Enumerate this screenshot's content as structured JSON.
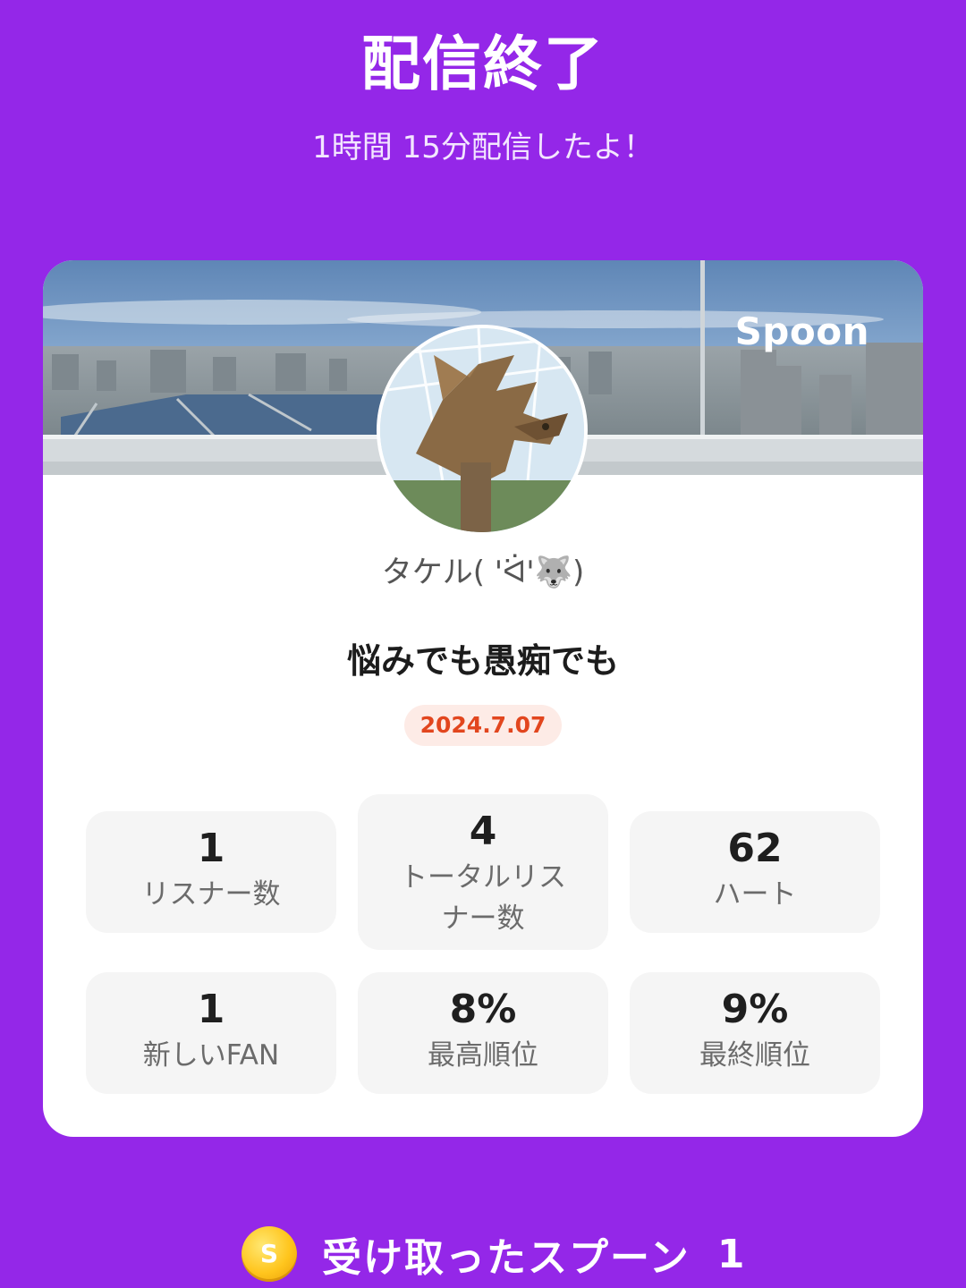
{
  "header": {
    "title": "配信終了",
    "subtitle": "1時間 15分配信したよ！"
  },
  "card": {
    "brand_logo": "Spoon",
    "username": "タケル( 'ᐛ'🐺)",
    "live_title": "悩みでも愚痴でも",
    "date": "2024.7.07"
  },
  "stats": [
    {
      "value": "1",
      "label": "リスナー数"
    },
    {
      "value": "4",
      "label": "トータルリスナー数"
    },
    {
      "value": "62",
      "label": "ハート"
    },
    {
      "value": "1",
      "label": "新しいFAN"
    },
    {
      "value": "8%",
      "label": "最高順位"
    },
    {
      "value": "9%",
      "label": "最終順位"
    }
  ],
  "footer": {
    "coin_icon": "spoon-coin-icon",
    "coin_letter": "S",
    "received_label": "受け取ったスプーン",
    "received_count": "1"
  },
  "colors": {
    "background": "#9427e8",
    "card": "#ffffff",
    "date_text": "#e2461e",
    "date_badge_bg": "#fdebe6",
    "stat_bg": "#f5f5f5",
    "coin": "#ffc51d"
  }
}
